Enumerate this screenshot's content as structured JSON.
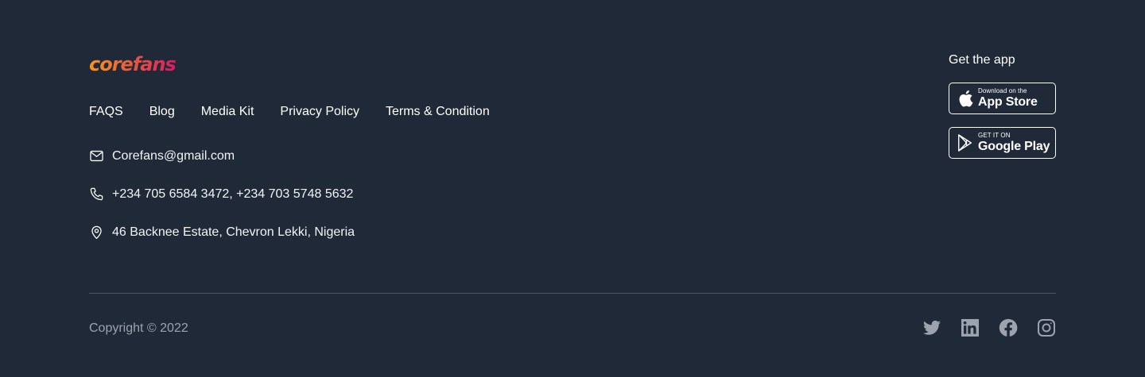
{
  "brand": {
    "logo_text": "corefans",
    "colors": {
      "gradient_start": "#f7941d",
      "gradient_end": "#d81b60"
    }
  },
  "nav": {
    "items": [
      {
        "label": "FAQS"
      },
      {
        "label": "Blog"
      },
      {
        "label": "Media Kit"
      },
      {
        "label": "Privacy Policy"
      },
      {
        "label": "Terms & Condition"
      }
    ]
  },
  "contact": {
    "email": {
      "icon": "mail-icon",
      "text": "Corefans@gmail.com"
    },
    "phone": {
      "icon": "phone-icon",
      "text": "+234 705 6584 3472, +234 703 5748 5632"
    },
    "address": {
      "icon": "location-pin-icon",
      "text": "46 Backnee Estate, Chevron Lekki, Nigeria"
    }
  },
  "app": {
    "title": "Get the app",
    "app_store": {
      "icon": "apple-icon",
      "small": "Download on the",
      "big": "App Store"
    },
    "google_play": {
      "icon": "google-play-icon",
      "small": "GET IT ON",
      "big": "Google Play"
    }
  },
  "footer": {
    "copyright": "Copyright © 2022"
  },
  "socials": [
    {
      "icon": "twitter-icon"
    },
    {
      "icon": "linkedin-icon"
    },
    {
      "icon": "facebook-icon"
    },
    {
      "icon": "instagram-icon"
    }
  ],
  "colors": {
    "background": "#1f2937",
    "text": "#ffffff",
    "muted": "#9ca3af",
    "social_icon": "#9ca3af",
    "divider": "#4b5563"
  }
}
